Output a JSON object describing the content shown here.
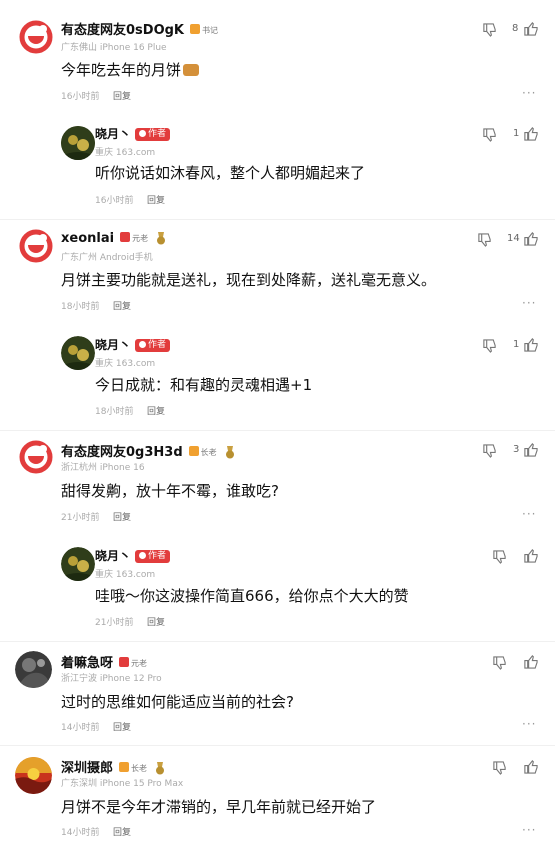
{
  "comments": [
    {
      "name": "有态度网友0sDOgK",
      "badge": "书记",
      "meta": "广东佛山 iPhone 16 Plue",
      "text": "今年吃去年的月饼",
      "time": "16小时前",
      "reply_label": "回复",
      "dislike_icon": "thumbs-down-icon",
      "like_count": "8",
      "like_icon": "thumbs-up-icon",
      "more": "···"
    },
    {
      "name": "晓月丶",
      "badge": "作者",
      "meta": "重庆 163.com",
      "text": "听你说话如沐春风，整个人都明媚起来了",
      "time": "16小时前",
      "reply_label": "回复",
      "like_count": "1"
    },
    {
      "name": "xeonlai",
      "badge": "元老",
      "meta": "广东广州 Android手机",
      "text": "月饼主要功能就是送礼，现在到处降薪，送礼毫无意义。",
      "time": "18小时前",
      "reply_label": "回复",
      "like_count": "14",
      "more": "···"
    },
    {
      "name": "晓月丶",
      "badge": "作者",
      "meta": "重庆 163.com",
      "text": "今日成就：和有趣的灵魂相遇+1",
      "time": "18小时前",
      "reply_label": "回复",
      "like_count": "1"
    },
    {
      "name": "有态度网友0g3H3d",
      "badge": "长老",
      "meta": "浙江杭州 iPhone 16",
      "text": "甜得发齁，放十年不霉，谁敢吃?",
      "time": "21小时前",
      "reply_label": "回复",
      "like_count": "3",
      "more": "···"
    },
    {
      "name": "晓月丶",
      "badge": "作者",
      "meta": "重庆 163.com",
      "text": "哇哦～你这波操作简直666，给你点个大大的赞",
      "time": "21小时前",
      "reply_label": "回复"
    },
    {
      "name": "着嘛急呀",
      "badge": "元老",
      "meta": "浙江宁波 iPhone 12 Pro",
      "text": "过时的思维如何能适应当前的社会?",
      "time": "14小时前",
      "reply_label": "回复",
      "more": "···"
    },
    {
      "name": "深圳摄郎",
      "badge": "长老",
      "meta": "广东深圳 iPhone 15 Pro Max",
      "text": "月饼不是今年才滞销的，早几年前就已经开始了",
      "time": "14小时前",
      "reply_label": "回复",
      "more": "···"
    }
  ],
  "colors": {
    "accent_red": "#e23c3c",
    "badge_gold": "#f0a030",
    "meta_gray": "#aaaaaa"
  }
}
